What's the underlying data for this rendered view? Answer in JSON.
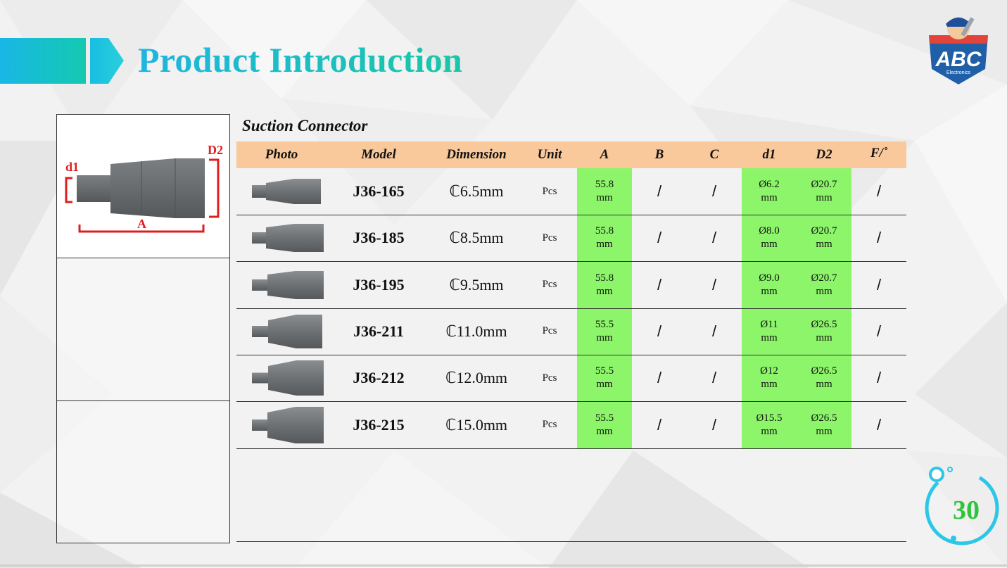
{
  "page": {
    "title": "Product Introduction",
    "subtitle": "Suction Connector",
    "page_number": "30",
    "logo_text": "ABC",
    "logo_subtext": "Electronics"
  },
  "diagram": {
    "label_d1": "d1",
    "label_d2": "D2",
    "label_a": "A"
  },
  "table": {
    "headers": [
      "Photo",
      "Model",
      "Dimension",
      "Unit",
      "A",
      "B",
      "C",
      "d1",
      "D2",
      "F/˚"
    ],
    "rows": [
      {
        "model": "J36-165",
        "dimension": "ℂ6.5mm",
        "unit": "Pcs",
        "a": [
          "55.8",
          "mm"
        ],
        "b": "/",
        "c": "/",
        "d1": [
          "Ø6.2",
          "mm"
        ],
        "d2": [
          "Ø20.7",
          "mm"
        ],
        "f": "/"
      },
      {
        "model": "J36-185",
        "dimension": "ℂ8.5mm",
        "unit": "Pcs",
        "a": [
          "55.8",
          "mm"
        ],
        "b": "/",
        "c": "/",
        "d1": [
          "Ø8.0",
          "mm"
        ],
        "d2": [
          "Ø20.7",
          "mm"
        ],
        "f": "/"
      },
      {
        "model": "J36-195",
        "dimension": "ℂ9.5mm",
        "unit": "Pcs",
        "a": [
          "55.8",
          "mm"
        ],
        "b": "/",
        "c": "/",
        "d1": [
          "Ø9.0",
          "mm"
        ],
        "d2": [
          "Ø20.7",
          "mm"
        ],
        "f": "/"
      },
      {
        "model": "J36-211",
        "dimension": "ℂ11.0mm",
        "unit": "Pcs",
        "a": [
          "55.5",
          "mm"
        ],
        "b": "/",
        "c": "/",
        "d1": [
          "Ø11",
          "mm"
        ],
        "d2": [
          "Ø26.5",
          "mm"
        ],
        "f": "/"
      },
      {
        "model": "J36-212",
        "dimension": "ℂ12.0mm",
        "unit": "Pcs",
        "a": [
          "55.5",
          "mm"
        ],
        "b": "/",
        "c": "/",
        "d1": [
          "Ø12",
          "mm"
        ],
        "d2": [
          "Ø26.5",
          "mm"
        ],
        "f": "/"
      },
      {
        "model": "J36-215",
        "dimension": "ℂ15.0mm",
        "unit": "Pcs",
        "a": [
          "55.5",
          "mm"
        ],
        "b": "/",
        "c": "/",
        "d1": [
          "Ø15.5",
          "mm"
        ],
        "d2": [
          "Ø26.5",
          "mm"
        ],
        "f": "/"
      }
    ]
  },
  "colors": {
    "accent_teal": "#22b8cf",
    "header_fill": "#f9c99b",
    "highlight_green": "#8df56a",
    "dimension_red": "#e01d1d",
    "page_number_green": "#2ec43a"
  },
  "icons": [
    "mechanic-logo-icon",
    "connector-photo-icon",
    "page-number-ring-icon"
  ]
}
